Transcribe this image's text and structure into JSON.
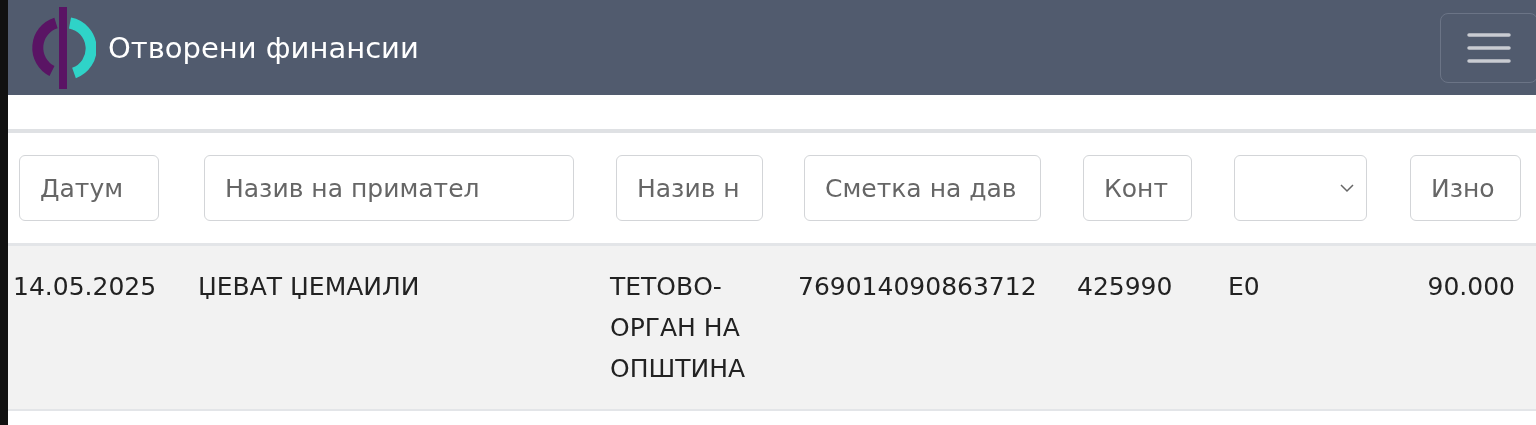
{
  "navbar": {
    "title": "Отворени финансии"
  },
  "filters": [
    {
      "kind": "text",
      "placeholder": "Датум"
    },
    {
      "kind": "text",
      "placeholder": "Назив на примател"
    },
    {
      "kind": "text",
      "placeholder": "Назив н"
    },
    {
      "kind": "text",
      "placeholder": "Сметка на дав"
    },
    {
      "kind": "text",
      "placeholder": "Конт"
    },
    {
      "kind": "select"
    },
    {
      "kind": "text",
      "placeholder": "Изно"
    }
  ],
  "rows": [
    {
      "cells": [
        "14.05.2025",
        "ЏЕВАТ ЏЕМАИЛИ",
        "ТЕТОВО-ОРГАН НА ОПШТИНА",
        "769014090863712",
        "425990",
        "Е0",
        "90.000"
      ]
    }
  ]
}
